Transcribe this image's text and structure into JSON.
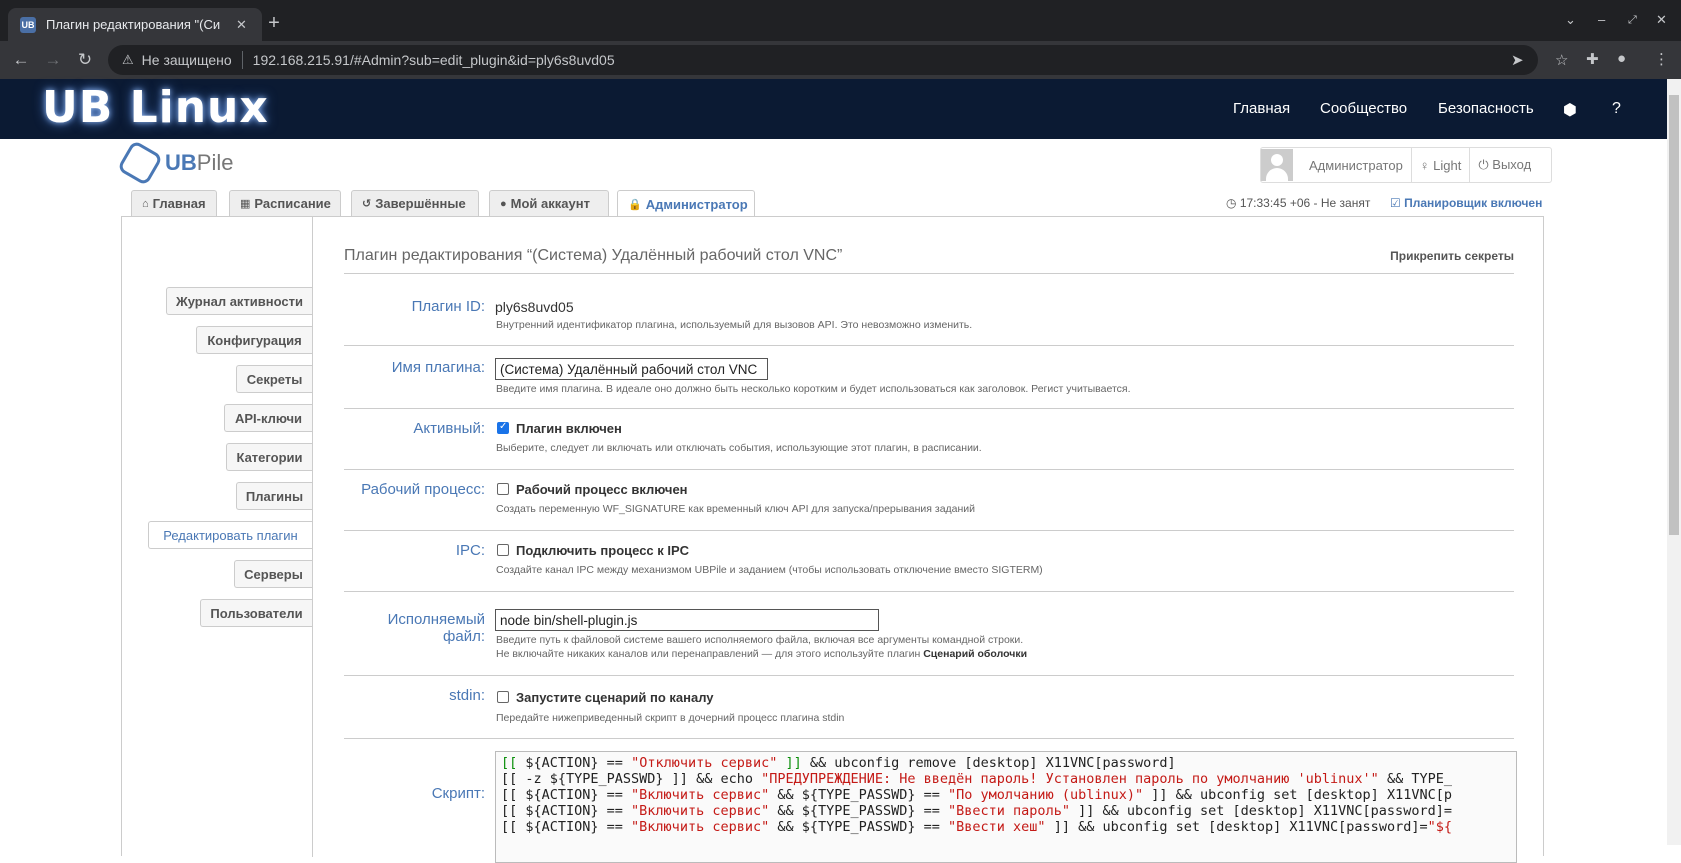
{
  "browser": {
    "tab_title": "Плагин редактирования \"(Си",
    "tab_favicon": "UB",
    "tab_close": "✕",
    "new_tab": "+",
    "insecure_label": "Не защищено",
    "url": "192.168.215.91/#Admin?sub=edit_plugin&id=ply6s8uvd05"
  },
  "site": {
    "logo": "UB Linux",
    "nav": [
      "Главная",
      "Сообщество",
      "Безопасность"
    ],
    "help": "?"
  },
  "ubpile": {
    "logo_prefix": "UB",
    "logo_suffix": "Pile",
    "user_name": "Администратор",
    "theme_label": "Light",
    "logout_label": "Выход",
    "tabs": [
      {
        "label": "Главная",
        "icon": "home-icon"
      },
      {
        "label": "Расписание",
        "icon": "calendar-icon"
      },
      {
        "label": "Завершённые",
        "icon": "history-icon"
      },
      {
        "label": "Мой аккаунт",
        "icon": "user-icon"
      },
      {
        "label": "Администратор",
        "icon": "lock-icon"
      }
    ],
    "clock": "17:33:45 +06 - Не занят",
    "scheduler": "Планировщик включен"
  },
  "sidebar": {
    "items": [
      "Журнал активности",
      "Конфигурация",
      "Секреты",
      "API-ключи",
      "Категории",
      "Плагины",
      "Редактировать плагин",
      "Серверы",
      "Пользователи"
    ],
    "active": "Редактировать плагин"
  },
  "page": {
    "title": "Плагин редактирования “(Система) Удалённый рабочий стол VNC”",
    "pin_secrets": "Прикрепить секреты"
  },
  "fields": {
    "plugin_id": {
      "label": "Плагин ID:",
      "value": "ply6s8uvd05",
      "help": "Внутренний идентификатор плагина, используемый для вызовов API. Это невозможно изменить."
    },
    "plugin_name": {
      "label": "Имя плагина:",
      "value": "(Система) Удалённый рабочий стол VNC",
      "help": "Введите имя плагина. В идеале оно должно быть несколько коротким и будет использоваться как заголовок. Регист учитывается."
    },
    "active": {
      "label": "Активный:",
      "checkbox": "Плагин включен",
      "checked": true,
      "help": "Выберите, следует ли включать или отключать события, использующие этот плагин, в расписании."
    },
    "workflow": {
      "label": "Рабочий процесс:",
      "checkbox": "Рабочий процесс включен",
      "checked": false,
      "help": "Создать переменную WF_SIGNATURE как временный ключ API для запуска/прерывания заданий"
    },
    "ipc": {
      "label": "IPC:",
      "checkbox": "Подключить процесс к IPC",
      "checked": false,
      "help": "Создайте канал IPC между механизмом UBPile и заданием (чтобы использовать отключение вместо SIGTERM)"
    },
    "executable": {
      "label": "Исполняемый файл:",
      "value": "node bin/shell-plugin.js",
      "help1": "Введите путь к файловой системе вашего исполняемого файла, включая все аргументы командной строки.",
      "help2_prefix": "Не включайте никаких каналов или перенаправлений — для этого используйте плагин",
      "help2_bold": "Сценарий оболочки"
    },
    "stdin": {
      "label": "stdin:",
      "checkbox": "Запустите сценарий по каналу",
      "checked": false,
      "help": "Передайте нижеприведенный скрипт в дочерний процесс плагина stdin"
    },
    "script": {
      "label": "Скрипт:",
      "lines": [
        [
          [
            "g",
            "[[ "
          ],
          [
            "",
            "${ACTION} == "
          ],
          [
            "s",
            "\"Отключить сервис\""
          ],
          [
            "g",
            " ]]"
          ],
          [
            "",
            " && ubconfig remove [desktop] X11VNC[password]"
          ]
        ],
        [
          [
            "",
            "[[ -z ${TYPE_PASSWD} ]] && echo "
          ],
          [
            "s",
            "\"ПРЕДУПРЕЖДЕНИЕ: Не введён пароль! Установлен пароль по умолчанию 'ublinux'\""
          ],
          [
            "",
            " && TYPE_"
          ]
        ],
        [
          [
            "",
            "[[ ${ACTION} == "
          ],
          [
            "s",
            "\"Включить сервис\""
          ],
          [
            "",
            " && ${TYPE_PASSWD} == "
          ],
          [
            "s",
            "\"По умолчанию (ublinux)\""
          ],
          [
            "",
            " ]] && ubconfig set [desktop] X11VNC[p"
          ]
        ],
        [
          [
            "",
            "[[ ${ACTION} == "
          ],
          [
            "s",
            "\"Включить сервис\""
          ],
          [
            "",
            " && ${TYPE_PASSWD} == "
          ],
          [
            "s",
            "\"Ввести пароль\""
          ],
          [
            "",
            " ]] && ubconfig set [desktop] X11VNC[password]="
          ]
        ],
        [
          [
            "",
            "[[ ${ACTION} == "
          ],
          [
            "s",
            "\"Включить сервис\""
          ],
          [
            "",
            " && ${TYPE_PASSWD} == "
          ],
          [
            "s",
            "\"Ввести хеш\""
          ],
          [
            "",
            " ]] && ubconfig set [desktop] X11VNC[password]="
          ],
          [
            "s",
            "\"${"
          ]
        ]
      ]
    }
  }
}
